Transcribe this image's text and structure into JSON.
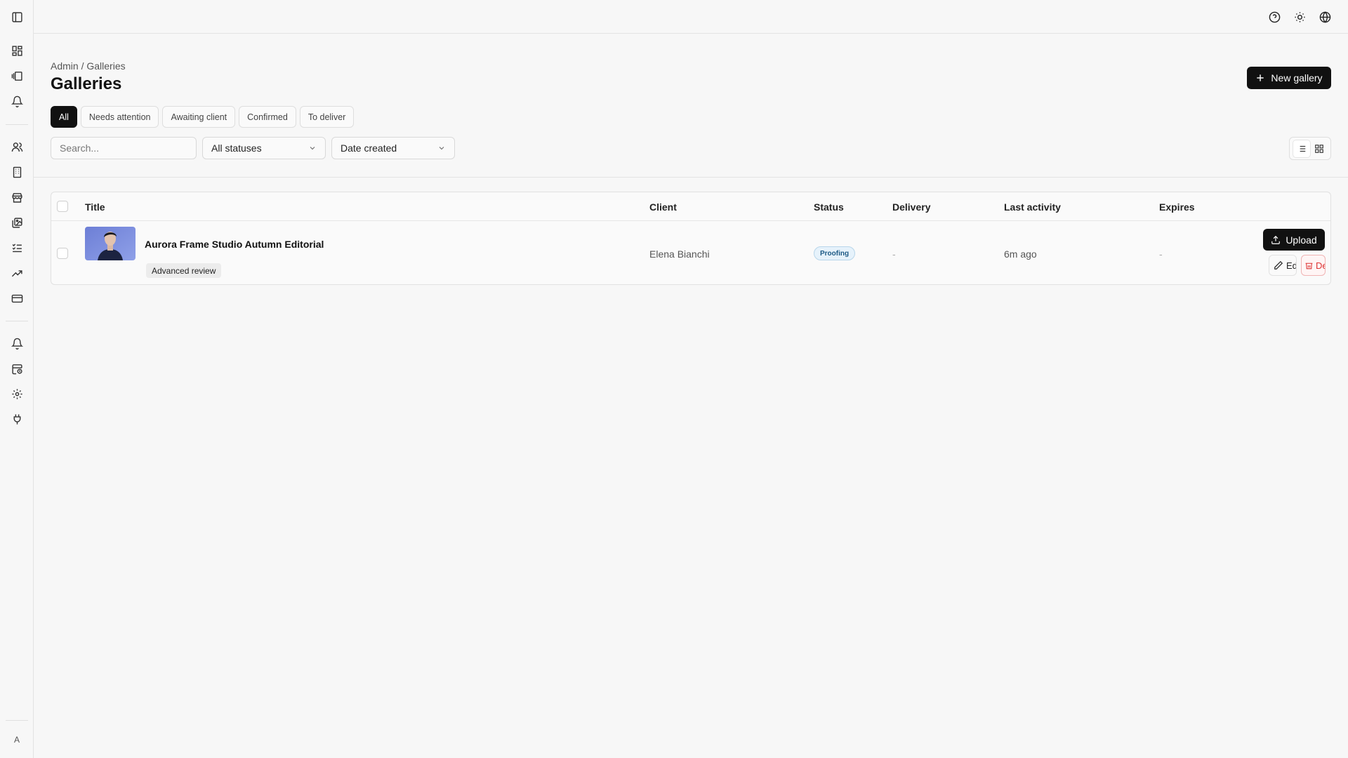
{
  "breadcrumb": {
    "root": "Admin",
    "separator": "/",
    "current": "Galleries"
  },
  "page": {
    "title": "Galleries",
    "new_button": "New gallery"
  },
  "tabs": [
    {
      "label": "All",
      "active": true
    },
    {
      "label": "Needs attention",
      "active": false
    },
    {
      "label": "Awaiting client",
      "active": false
    },
    {
      "label": "Confirmed",
      "active": false
    },
    {
      "label": "To deliver",
      "active": false
    }
  ],
  "filters": {
    "search_placeholder": "Search...",
    "status_select": "All statuses",
    "sort_select": "Date created"
  },
  "view_toggle": {
    "active": "list"
  },
  "table": {
    "columns": [
      "Title",
      "Client",
      "Status",
      "Delivery",
      "Last activity",
      "Expires"
    ],
    "rows": [
      {
        "title": "Aurora Frame Studio Autumn Editorial",
        "tag": "Advanced review",
        "client": "Elena Bianchi",
        "status": "Proofing",
        "delivery": "-",
        "last_activity": "6m ago",
        "expires": "-",
        "actions": {
          "upload": "Upload",
          "edit": "Edit",
          "delete": "Delete"
        }
      }
    ]
  },
  "sidebar": {
    "icons": [
      "sidebar-toggle-icon",
      "dashboard-icon",
      "galleries-icon",
      "alarm-icon",
      "users-icon",
      "building-icon",
      "store-icon",
      "images-icon",
      "checklist-icon",
      "trending-icon",
      "card-icon",
      "alarm-icon",
      "calendar-clock-icon",
      "gear-icon",
      "plug-icon"
    ],
    "avatar": "A"
  },
  "topbar": {
    "icons": [
      "help-icon",
      "sun-icon",
      "globe-icon"
    ]
  },
  "colors": {
    "accent": "#111111",
    "status_proofing_bg": "#e6f2fb",
    "status_proofing_text": "#1d5a85",
    "danger": "#dd3333"
  }
}
